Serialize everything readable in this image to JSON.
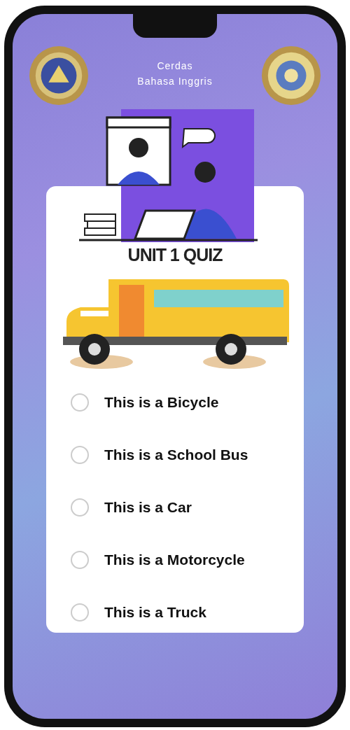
{
  "header": {
    "title_lines": [
      "Cerdas",
      "Bahasa Inggris"
    ]
  },
  "quiz": {
    "title": "UNIT 1 QUIZ",
    "options": [
      {
        "label": "This is a Bicycle",
        "selected": false
      },
      {
        "label": "This is a School Bus",
        "selected": false
      },
      {
        "label": "This is a Car",
        "selected": false
      },
      {
        "label": "This is a Motorcycle",
        "selected": false
      },
      {
        "label": "This is a Truck",
        "selected": false
      }
    ]
  }
}
